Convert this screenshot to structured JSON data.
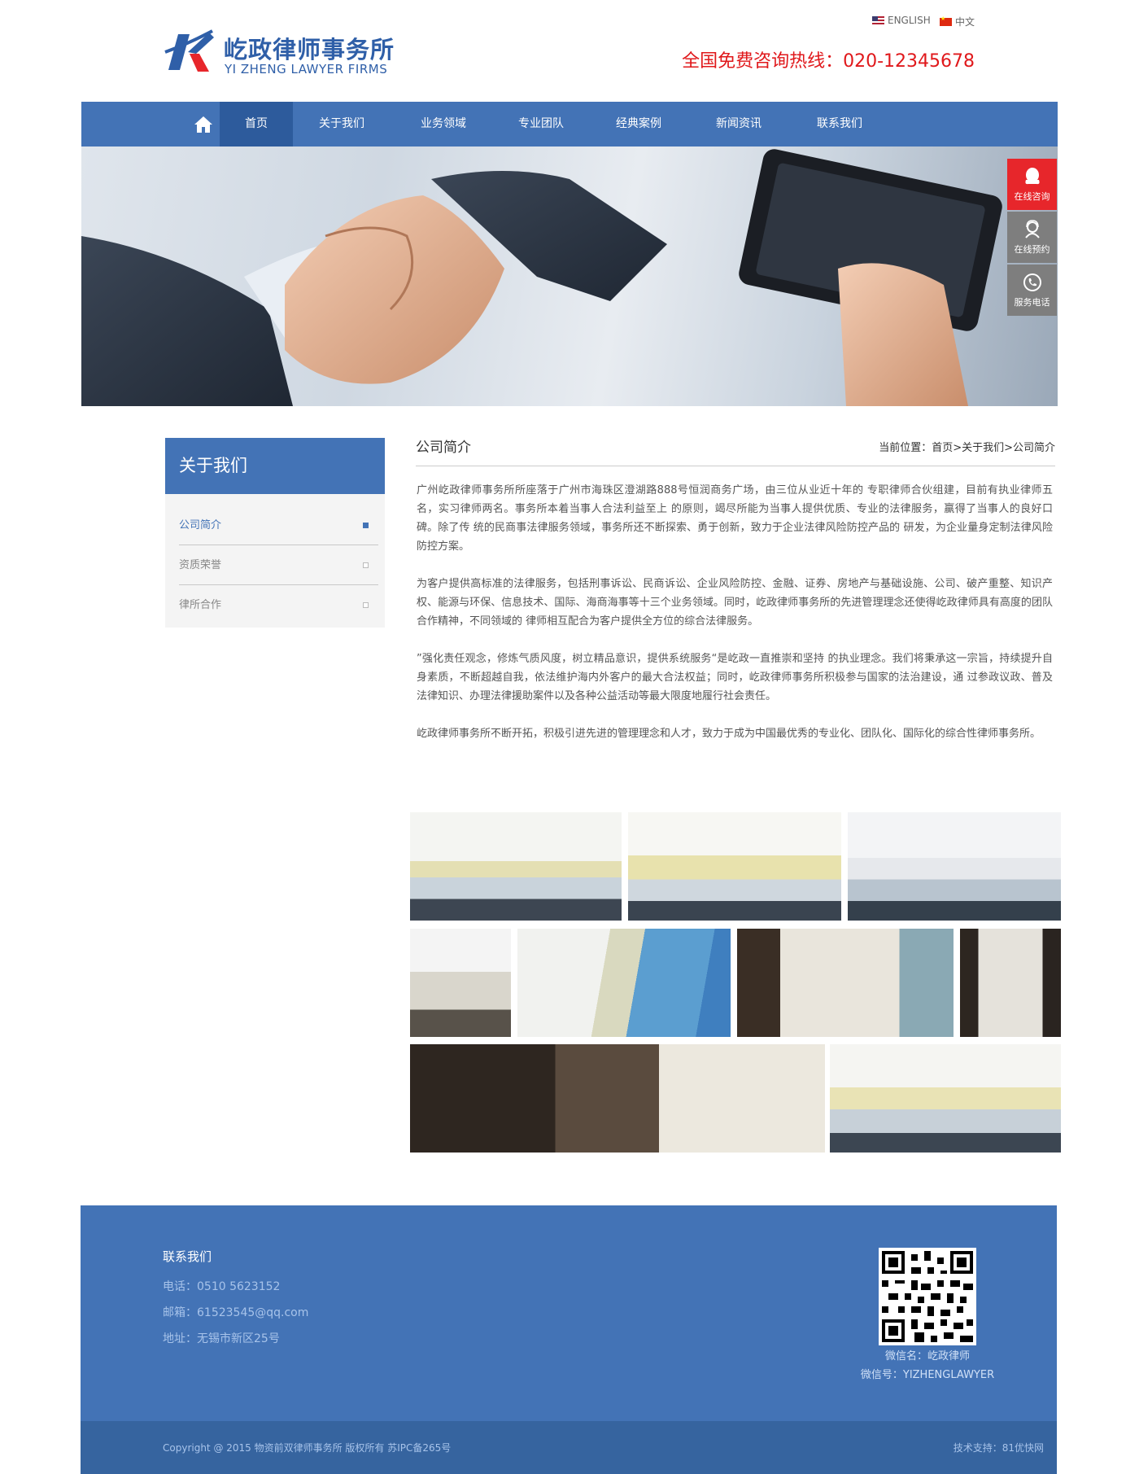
{
  "header": {
    "logo_cn": "屹政律师事务所",
    "logo_en": "YI ZHENG LAWYER FIRMS",
    "lang_en": "ENGLISH",
    "lang_cn": "中文",
    "hotline": "全国免费咨询热线：020-12345678"
  },
  "nav": {
    "items": [
      {
        "label": "首页"
      },
      {
        "label": "关于我们"
      },
      {
        "label": "业务领域"
      },
      {
        "label": "专业团队"
      },
      {
        "label": "经典案例"
      },
      {
        "label": "新闻资讯"
      },
      {
        "label": "联系我们"
      }
    ]
  },
  "float_bar": {
    "items": [
      {
        "label": "在线咨询",
        "icon": "qq-icon"
      },
      {
        "label": "在线预约",
        "icon": "service-agent-icon"
      },
      {
        "label": "服务电话",
        "icon": "phone-icon"
      }
    ]
  },
  "sidebar": {
    "title": "关于我们",
    "links": [
      {
        "label": "公司简介"
      },
      {
        "label": "资质荣誉"
      },
      {
        "label": "律所合作"
      }
    ]
  },
  "content": {
    "title": "公司简介",
    "breadcrumb": "当前位置：首页>关于我们>公司简介",
    "paragraphs": [
      "广州屹政律师事务所所座落于广州市海珠区澄湖路888号恒润商务广场，由三位从业近十年的 专职律师合伙组建，目前有执业律师五名，实习律师两名。事务所本着当事人合法利益至上 的原则，竭尽所能为当事人提供优质、专业的法律服务，赢得了当事人的良好口碑。除了传 统的民商事法律服务领域，事务所还不断探索、勇于创新，致力于企业法律风险防控产品的 研发，为企业量身定制法律风险防控方案。",
      "为客户提供高标准的法律服务，包括刑事诉讼、民商诉讼、企业风险防控、金融、证券、房地产与基础设施、公司、破产重整、知识产权、能源与环保、信息技术、国际、海商海事等十三个业务领域。同时，屹政律师事务所的先进管理理念还使得屹政律师具有高度的团队合作精神，不同领域的 律师相互配合为客户提供全方位的综合法律服务。",
      "”强化责任观念，修炼气质风度，树立精品意识，提供系统服务“是屹政一直推崇和坚持 的执业理念。我们将秉承这一宗旨，持续提升自身素质，不断超越自我，依法维护海内外客户的最大合法权益；同时，屹政律师事务所积极参与国家的法治建设，通 过参政议政、普及法律知识、办理法律援助案件以及各种公益活动等最大限度地履行社会责任。",
      "屹政律师事务所不断开拓，积极引进先进的管理理念和人才，致力于成为中国最优秀的专业化、团队化、国际化的综合性律师事务所。"
    ]
  },
  "footer": {
    "title": "联系我们",
    "phone": "电话：0510 5623152",
    "email": "邮箱：61523545@qq.com",
    "address": "地址：无锡市新区25号",
    "wechat_name": "微信名：屹政律师",
    "wechat_id": "微信号：YIZHENGLAWYER",
    "copyright": "Copyright @ 2015 物资前双律师事务所 版权所有  苏IPC备265号",
    "tech": "技术支持：81优快网"
  },
  "colors": {
    "brand_blue": "#4373b6",
    "nav_active": "#2d5b9c",
    "hotline_red": "#e0181b",
    "float_red": "#e7262b"
  }
}
